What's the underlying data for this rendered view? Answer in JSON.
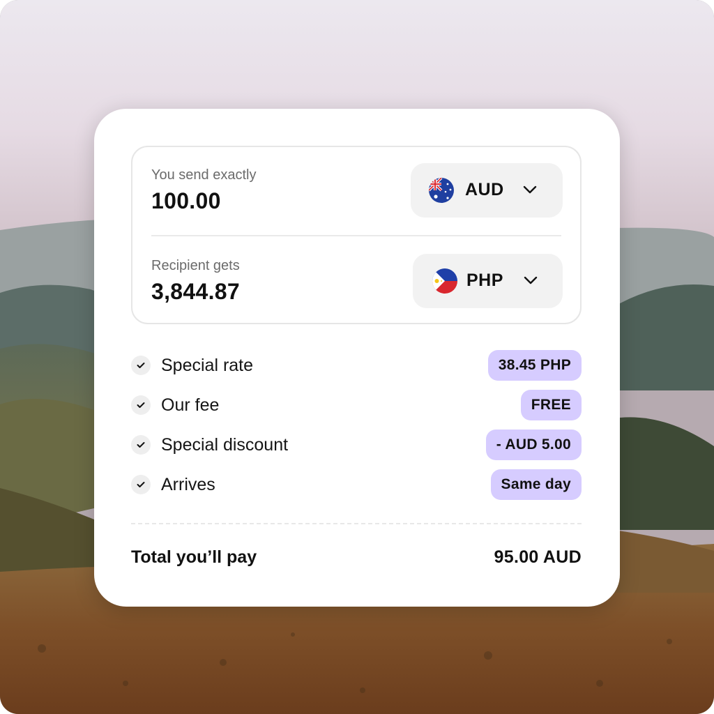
{
  "converter": {
    "send": {
      "label": "You send exactly",
      "amount": "100.00",
      "currency": "AUD",
      "flag_icon": "australia-flag-icon"
    },
    "receive": {
      "label": "Recipient gets",
      "amount": "3,844.87",
      "currency": "PHP",
      "flag_icon": "philippines-flag-icon"
    }
  },
  "details": [
    {
      "label": "Special rate",
      "value": "38.45 PHP"
    },
    {
      "label": "Our fee",
      "value": "FREE"
    },
    {
      "label": "Special discount",
      "value": "- AUD 5.00"
    },
    {
      "label": "Arrives",
      "value": "Same day"
    }
  ],
  "total": {
    "label": "Total you’ll pay",
    "value": "95.00 AUD"
  },
  "colors": {
    "badge": "#d6ccff",
    "card": "#ffffff",
    "text": "#111111"
  }
}
